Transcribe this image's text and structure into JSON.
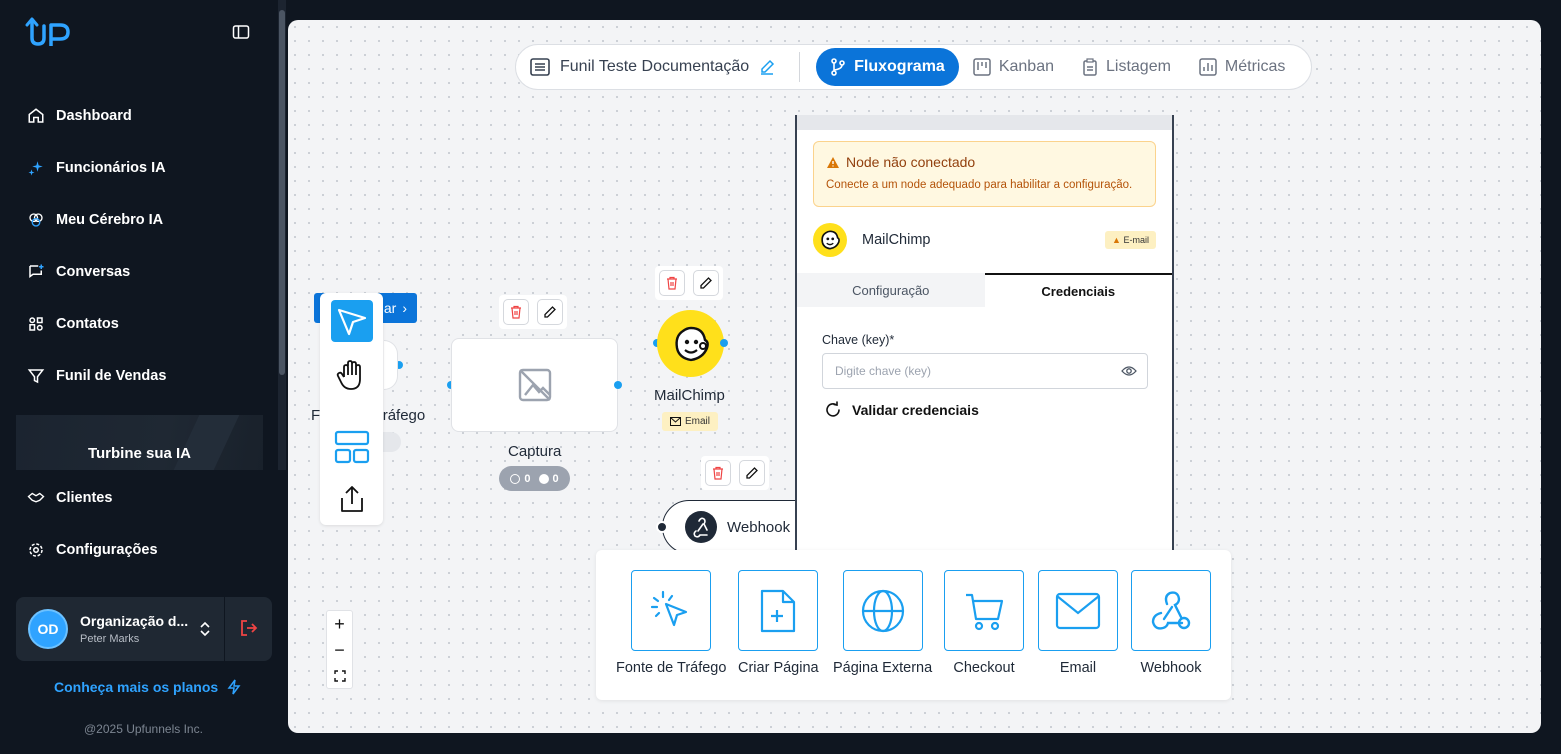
{
  "sidebar": {
    "logo": "UP",
    "items": [
      {
        "label": "Dashboard",
        "icon": "home-icon"
      },
      {
        "label": "Funcionários IA",
        "icon": "sparkles-icon"
      },
      {
        "label": "Meu Cérebro IA",
        "icon": "brain-icon"
      },
      {
        "label": "Conversas",
        "icon": "chat-icon"
      },
      {
        "label": "Contatos",
        "icon": "contacts-icon"
      },
      {
        "label": "Funil de Vendas",
        "icon": "funnel-icon"
      }
    ],
    "promo": "Turbine sua IA",
    "items2": [
      {
        "label": "Clientes",
        "icon": "handshake-icon"
      },
      {
        "label": "Configurações",
        "icon": "gear-icon"
      }
    ],
    "org": {
      "initials": "OD",
      "name": "Organização d...",
      "user": "Peter Marks"
    },
    "plans_link": "Conheça mais os planos",
    "copyright": "@2025 Upfunnels Inc."
  },
  "topbar": {
    "funnel_name": "Funil Teste Documentação",
    "tabs": [
      "Fluxograma",
      "Kanban",
      "Listagem",
      "Métricas"
    ],
    "active_tab": "Fluxograma"
  },
  "canvas": {
    "fonte_label": "Fonte de Tráfego",
    "blue_tab_label": "ar",
    "captura_label": "Captura",
    "captura_stats": {
      "a": "0",
      "b": "0"
    },
    "mailchimp_label": "MailChimp",
    "mailchimp_chip": "Email",
    "webhook_label": "Webhook",
    "zoom": [
      "+",
      "−",
      "⛶"
    ]
  },
  "panel": {
    "warning_title": "Node não conectado",
    "warning_desc": "Conecte a um node adequado para habilitar a configuração.",
    "node_name": "MailChimp",
    "node_chip": "E-mail",
    "tabs": [
      "Configuração",
      "Credenciais"
    ],
    "active_tab": "Credenciais",
    "field_label": "Chave (key)*",
    "field_placeholder": "Digite chave (key)",
    "validate_label": "Validar credenciais"
  },
  "palette": [
    {
      "label": "Fonte de Tráfego",
      "icon": "cursor-click-icon"
    },
    {
      "label": "Criar Página",
      "icon": "file-plus-icon"
    },
    {
      "label": "Página Externa",
      "icon": "globe-icon"
    },
    {
      "label": "Checkout",
      "icon": "cart-icon"
    },
    {
      "label": "Email",
      "icon": "mail-icon"
    },
    {
      "label": "Webhook",
      "icon": "webhook-icon"
    }
  ],
  "colors": {
    "primary": "#0b74d9",
    "accent": "#1a9ff0",
    "sidebar_bg": "#0f1620",
    "mailchimp": "#ffe01b"
  }
}
